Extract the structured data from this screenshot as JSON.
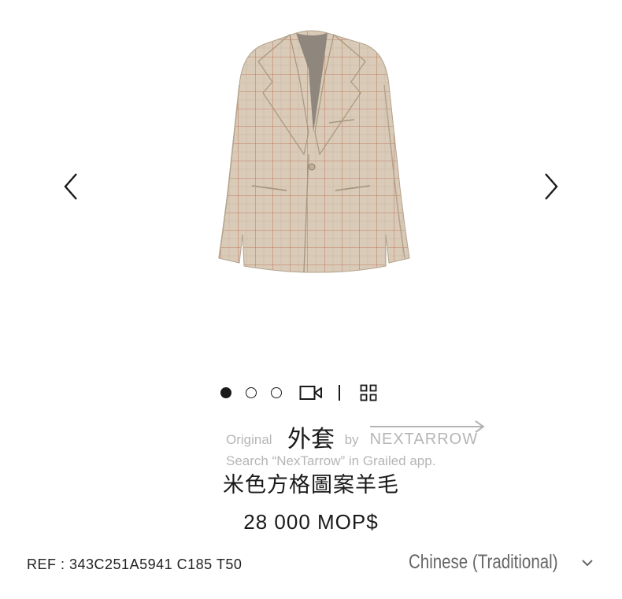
{
  "product": {
    "title": "外套",
    "subtitle": "米色方格圖案羊毛",
    "price": "28 000 MOP$",
    "ref": "REF : 343C251A5941 C185 T50",
    "image_description_icon": "beige-checked-blazer-image"
  },
  "gallery": {
    "dots": [
      "active",
      "inactive",
      "inactive"
    ],
    "icons": [
      "chevron-left-icon",
      "chevron-right-icon",
      "video-icon",
      "grid-view-icon"
    ]
  },
  "watermark": {
    "line1_prefix": "Original",
    "line1_partial": "by",
    "brand": "NEXTARROW",
    "line2": "Search “NexTarrow” in Grailed app."
  },
  "language": {
    "selected": "Chinese (Traditional)"
  },
  "colors": {
    "jacket_base": "#d9cbb8",
    "jacket_check": "#c0694f",
    "text": "#1a1a1a",
    "muted": "#666666"
  }
}
